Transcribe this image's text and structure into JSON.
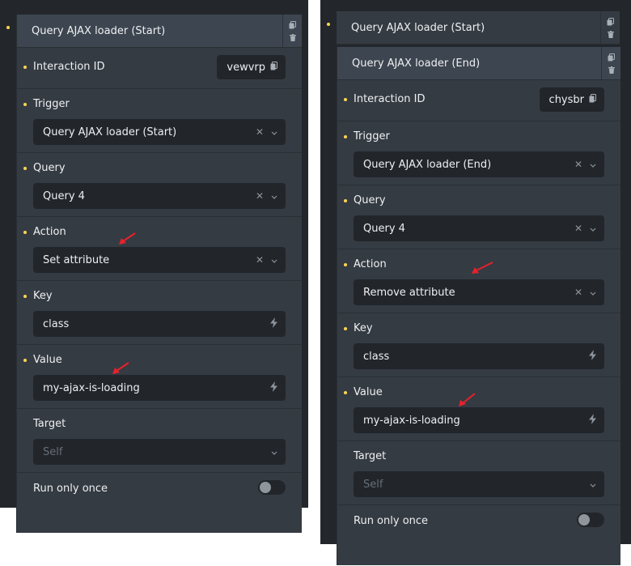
{
  "left": {
    "header": "Query AJAX loader (Start)",
    "interaction_id": {
      "label": "Interaction ID",
      "value": "vewvrp"
    },
    "trigger": {
      "label": "Trigger",
      "value": "Query AJAX loader (Start)"
    },
    "query": {
      "label": "Query",
      "value": "Query 4"
    },
    "action": {
      "label": "Action",
      "value": "Set attribute"
    },
    "key": {
      "label": "Key",
      "value": "class"
    },
    "value": {
      "label": "Value",
      "value": "my-ajax-is-loading"
    },
    "target": {
      "label": "Target",
      "placeholder": "Self"
    },
    "run_once": {
      "label": "Run only once",
      "enabled": false
    }
  },
  "right": {
    "collapsed_header": "Query AJAX loader (Start)",
    "header": "Query AJAX loader (End)",
    "interaction_id": {
      "label": "Interaction ID",
      "value": "chysbr"
    },
    "trigger": {
      "label": "Trigger",
      "value": "Query AJAX loader (End)"
    },
    "query": {
      "label": "Query",
      "value": "Query 4"
    },
    "action": {
      "label": "Action",
      "value": "Remove attribute"
    },
    "key": {
      "label": "Key",
      "value": "class"
    },
    "value": {
      "label": "Value",
      "value": "my-ajax-is-loading"
    },
    "target": {
      "label": "Target",
      "placeholder": "Self"
    },
    "run_once": {
      "label": "Run only once",
      "enabled": false
    }
  },
  "colors": {
    "accent_dot": "#ffd64f",
    "annotation_arrow": "#e8212b",
    "panel_bg": "#23272b",
    "card_bg": "#353b43",
    "field_bg": "#22262b"
  },
  "icons": [
    "copy-icon",
    "trash-icon",
    "clear-icon",
    "chevron-down-icon",
    "dynamic-data-icon"
  ]
}
